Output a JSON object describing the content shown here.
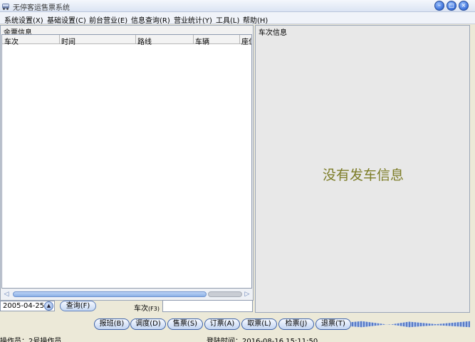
{
  "window": {
    "title": "无停客运售票系统",
    "buttons": {
      "minimize": "–",
      "restore": "□",
      "close": "×"
    }
  },
  "menu": [
    "系统设置(X)",
    "基础设置(C)",
    "前台营业(E)",
    "信息查询(R)",
    "营业统计(Y)",
    "工具(L)",
    "帮助(H)"
  ],
  "left_panel": {
    "title": "余票信息",
    "columns": [
      "车次",
      "时间",
      "路线",
      "车辆",
      "座位"
    ]
  },
  "right_panel": {
    "title": "车次信息",
    "empty_message": "没有发车信息"
  },
  "query_bar": {
    "date": "2005-04-25",
    "query_button": "查询(F)",
    "train_label": "车次",
    "train_key": "(F3)",
    "train_value": ""
  },
  "actions": [
    "报班(B)",
    "调度(D)",
    "售票(S)",
    "订票(A)",
    "取票(L)",
    "检票(J)",
    "退票(T)"
  ],
  "status": {
    "operator": "操作员：2号操作员",
    "login_time": "登陆时间：2016-08-16 15:11:50"
  },
  "colors": {
    "empty_message": "#7d7d28",
    "accent": "#3f63a8"
  }
}
